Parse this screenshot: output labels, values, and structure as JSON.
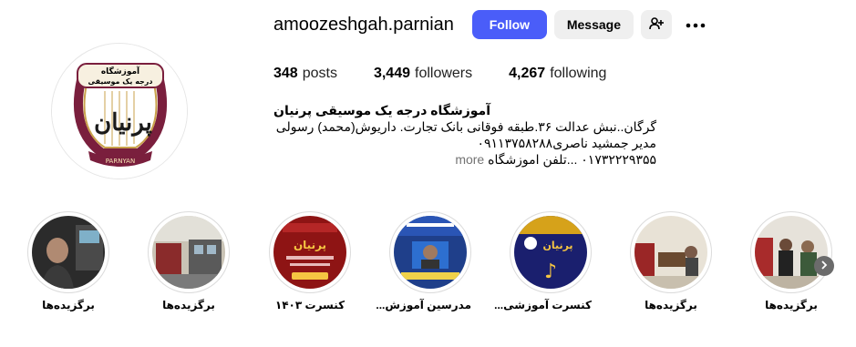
{
  "profile": {
    "username": "amoozeshgah.parnian",
    "follow_label": "Follow",
    "message_label": "Message",
    "logo_text_top": "آموزشگاه",
    "logo_text_sub": "درجه یک موسیقی",
    "logo_text_bottom": "PARNYAN"
  },
  "stats": {
    "posts_count": "348",
    "posts_label": "posts",
    "followers_count": "3,449",
    "followers_label": "followers",
    "following_count": "4,267",
    "following_label": "following"
  },
  "bio": {
    "name": "آموزشگاه درجه یک موسیقی پرنیان",
    "line1": "گرگان..نبش عدالت ۳۶.طبقه فوقانی بانک تجارت. داریوش(محمد) رسولی",
    "line2": "مدیر جمشید ناصری۰۹۱۱۳۷۵۸۲۸۸",
    "line3": "۰۱۷۳۲۲۲۹۳۵۵ ...تلفن اموزشگاه",
    "more_label": "more"
  },
  "highlights": [
    {
      "label": "برگزیده‌ها"
    },
    {
      "label": "برگزیده‌ها"
    },
    {
      "label": "کنسرت ۱۴۰۳"
    },
    {
      "label": "مدرسین آموزش..."
    },
    {
      "label": "کنسرت آموزشی..."
    },
    {
      "label": "برگزیده‌ها"
    },
    {
      "label": "برگزیده‌ها"
    }
  ],
  "colors": {
    "follow_bg": "#4a5df9",
    "secondary_bg": "#efefef",
    "logo_maroon": "#7a1f3d",
    "logo_gold": "#c9a24b"
  }
}
